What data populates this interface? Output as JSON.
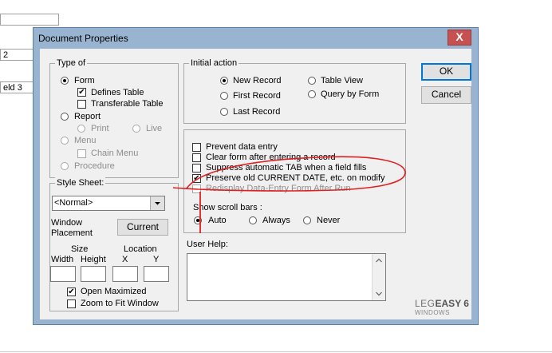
{
  "background": {
    "fields": [
      "2",
      "eld 3"
    ]
  },
  "dialog": {
    "title": "Document Properties",
    "close_label": "X",
    "type_of": {
      "legend": "Type of",
      "form": "Form",
      "defines_table": "Defines Table",
      "transferable_table": "Transferable Table",
      "report": "Report",
      "print": "Print",
      "live": "Live",
      "menu": "Menu",
      "chain_menu": "Chain Menu",
      "procedure": "Procedure"
    },
    "initial_action": {
      "legend": "Initial action",
      "new_record": "New Record",
      "first_record": "First Record",
      "last_record": "Last Record",
      "table_view": "Table View",
      "query_by_form": "Query by Form"
    },
    "options": {
      "prevent_data_entry": "Prevent data entry",
      "clear_form": "Clear form after entering a record",
      "suppress_tab": "Suppress automatic TAB when a field fills",
      "preserve_date": "Preserve old CURRENT DATE, etc. on modify",
      "redisplay": "Redisplay Data-Entry Form After Run"
    },
    "scroll_bars": {
      "label": "Show scroll bars :",
      "auto": "Auto",
      "always": "Always",
      "never": "Never"
    },
    "user_help": "User Help:",
    "style_sheet": {
      "legend": "Style Sheet:",
      "value": "<Normal>",
      "window_placement": "Window Placement",
      "current": "Current",
      "size": "Size",
      "location": "Location",
      "width": "Width",
      "height": "Height",
      "x": "X",
      "y": "Y",
      "open_maximized": "Open Maximized",
      "zoom_to_fit": "Zoom to Fit Window"
    },
    "ok": "OK",
    "cancel": "Cancel",
    "brand": {
      "leg": "LEG",
      "easy": "EASY 6",
      "sub": "WINDOWS"
    }
  },
  "annotation_color": "#e02020"
}
